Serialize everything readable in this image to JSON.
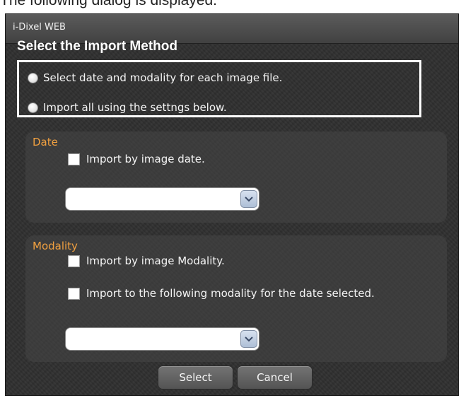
{
  "caption": "The following dialog is displayed.",
  "dialog": {
    "window_title": "i-Dixel WEB",
    "section_title": "Select the Import Method",
    "import_method": {
      "options": [
        {
          "label": "Select date and modality for each image file."
        },
        {
          "label": "Import all using the settngs below."
        }
      ]
    },
    "date_panel": {
      "heading": "Date",
      "checkbox_label": "Import by image date.",
      "select_value": ""
    },
    "modality_panel": {
      "heading": "Modality",
      "checkbox1_label": "Import by image Modality.",
      "checkbox2_label": "Import to the following modality for the date selected.",
      "select_value": ""
    },
    "buttons": {
      "select_label": "Select",
      "cancel_label": "Cancel"
    }
  },
  "icons": {
    "dropdown": "chevron-down-icon"
  }
}
